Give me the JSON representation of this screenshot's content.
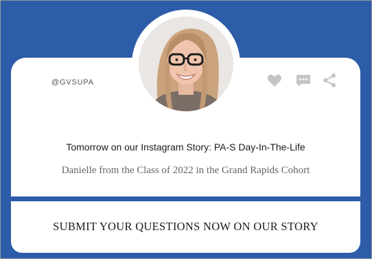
{
  "post": {
    "handle": "@GVSUPA",
    "headline": "Tomorrow on our Instagram Story: PA-S Day-In-The-Life",
    "subline": "Danielle from the Class of 2022 in the Grand Rapids Cohort",
    "cta": "SUBMIT YOUR QUESTIONS NOW ON OUR STORY"
  },
  "icons": [
    "heart-icon",
    "comment-icon",
    "share-icon"
  ],
  "colors": {
    "background": "#2d5ca8",
    "card": "#ffffff",
    "icon": "#c4c4c4"
  }
}
